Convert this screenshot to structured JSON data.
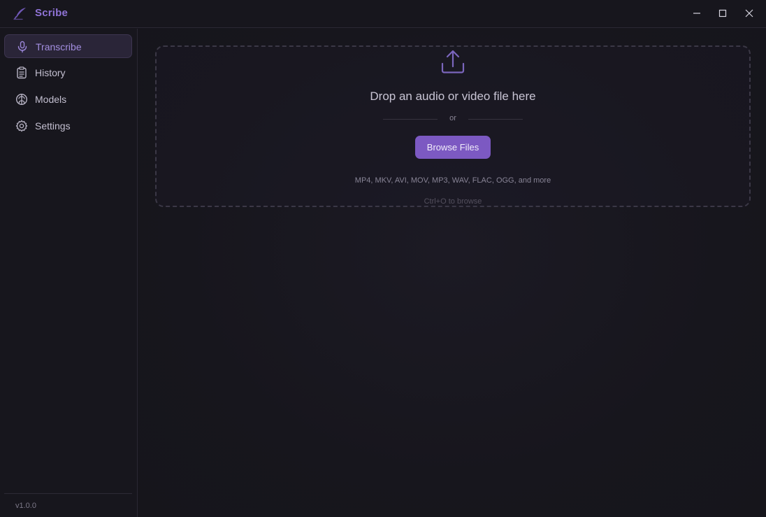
{
  "app": {
    "title": "Scribe",
    "version": "v1.0.0"
  },
  "window_controls": {
    "minimize": "minimize-icon",
    "maximize": "maximize-icon",
    "close": "close-icon"
  },
  "sidebar": {
    "items": [
      {
        "label": "Transcribe",
        "icon": "microphone-icon",
        "active": true
      },
      {
        "label": "History",
        "icon": "clipboard-icon",
        "active": false
      },
      {
        "label": "Models",
        "icon": "brain-icon",
        "active": false
      },
      {
        "label": "Settings",
        "icon": "gear-icon",
        "active": false
      }
    ]
  },
  "dropzone": {
    "icon": "upload-icon",
    "title": "Drop an audio or video file here",
    "separator": "or",
    "browse_label": "Browse Files",
    "formats": "MP4, MKV, AVI, MOV, MP3, WAV, FLAC, OGG, and more",
    "shortcut": "Ctrl+O to browse"
  },
  "colors": {
    "accent": "#7c59c2",
    "accent_text": "#8f73d6",
    "background": "#16151c"
  }
}
